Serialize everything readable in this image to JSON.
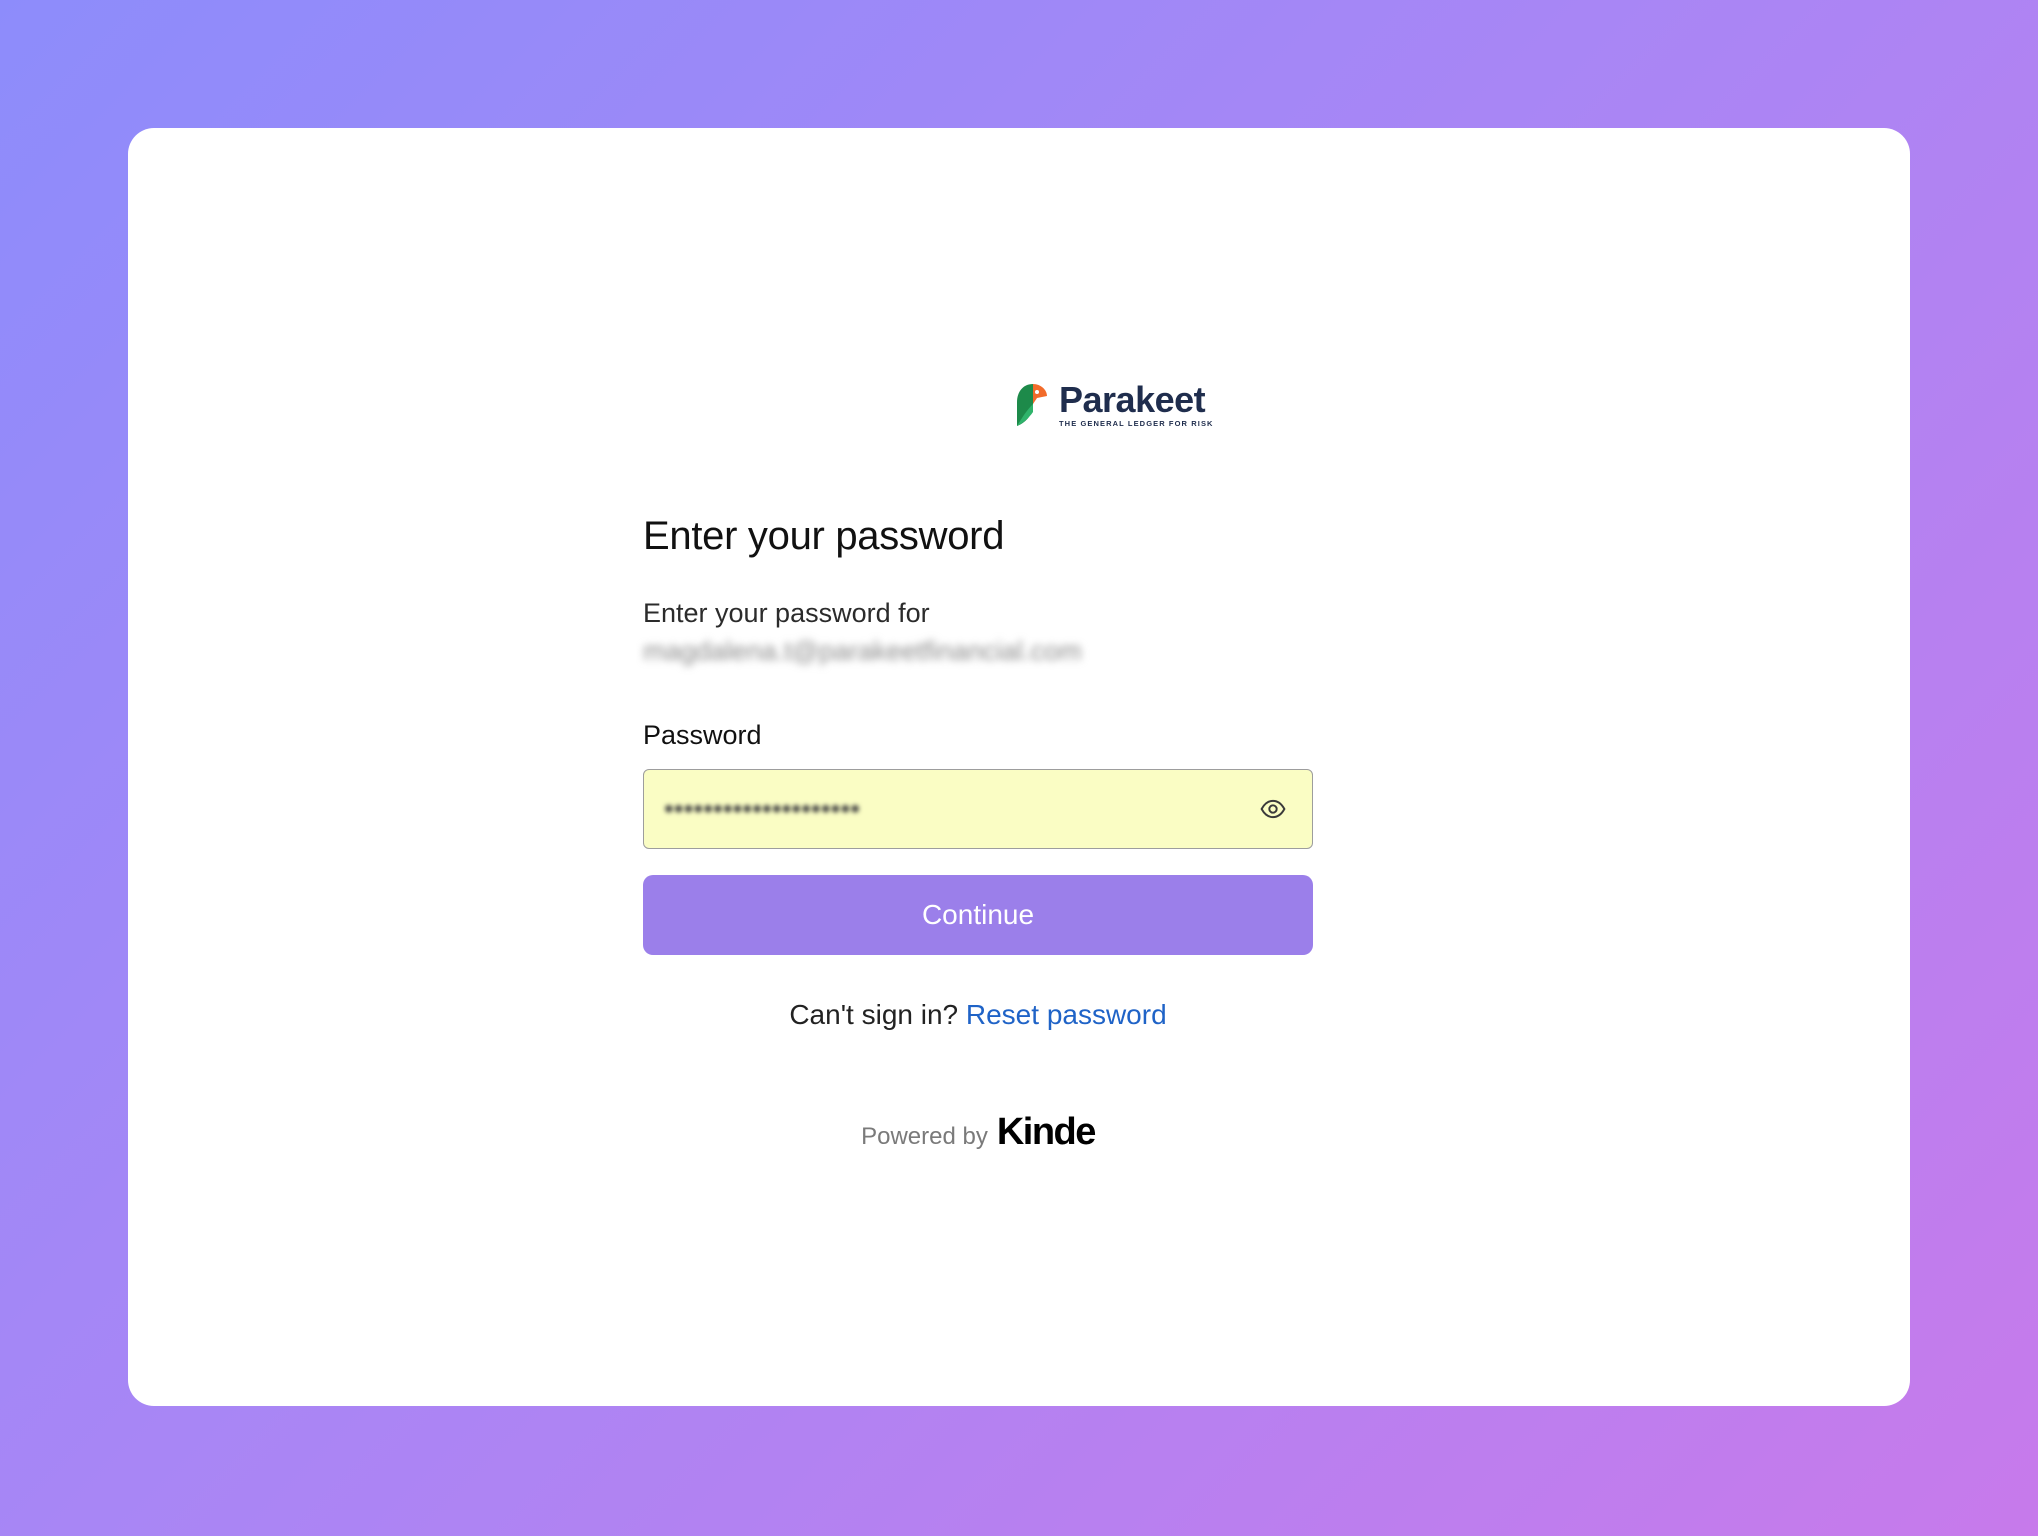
{
  "brand": {
    "name": "Parakeet",
    "tagline": "THE GENERAL LEDGER FOR RISK",
    "colors": {
      "green": "#1d8a4a",
      "orange": "#f26b2a",
      "navy": "#1f2d4d"
    }
  },
  "page": {
    "heading": "Enter your password",
    "subtext": "Enter your password for",
    "email": "magdalena.t@parakeetfinancial.com"
  },
  "form": {
    "password_label": "Password",
    "password_value": "••••••••••••••••••••",
    "show_password_icon": "eye-icon",
    "submit_label": "Continue"
  },
  "help": {
    "prompt": "Can't sign in?",
    "link": "Reset password"
  },
  "footer": {
    "powered_by": "Powered by",
    "provider": "Kinde"
  },
  "colors": {
    "button": "#9b7fea",
    "link": "#1f63c7",
    "input_bg": "#fafdc4"
  }
}
